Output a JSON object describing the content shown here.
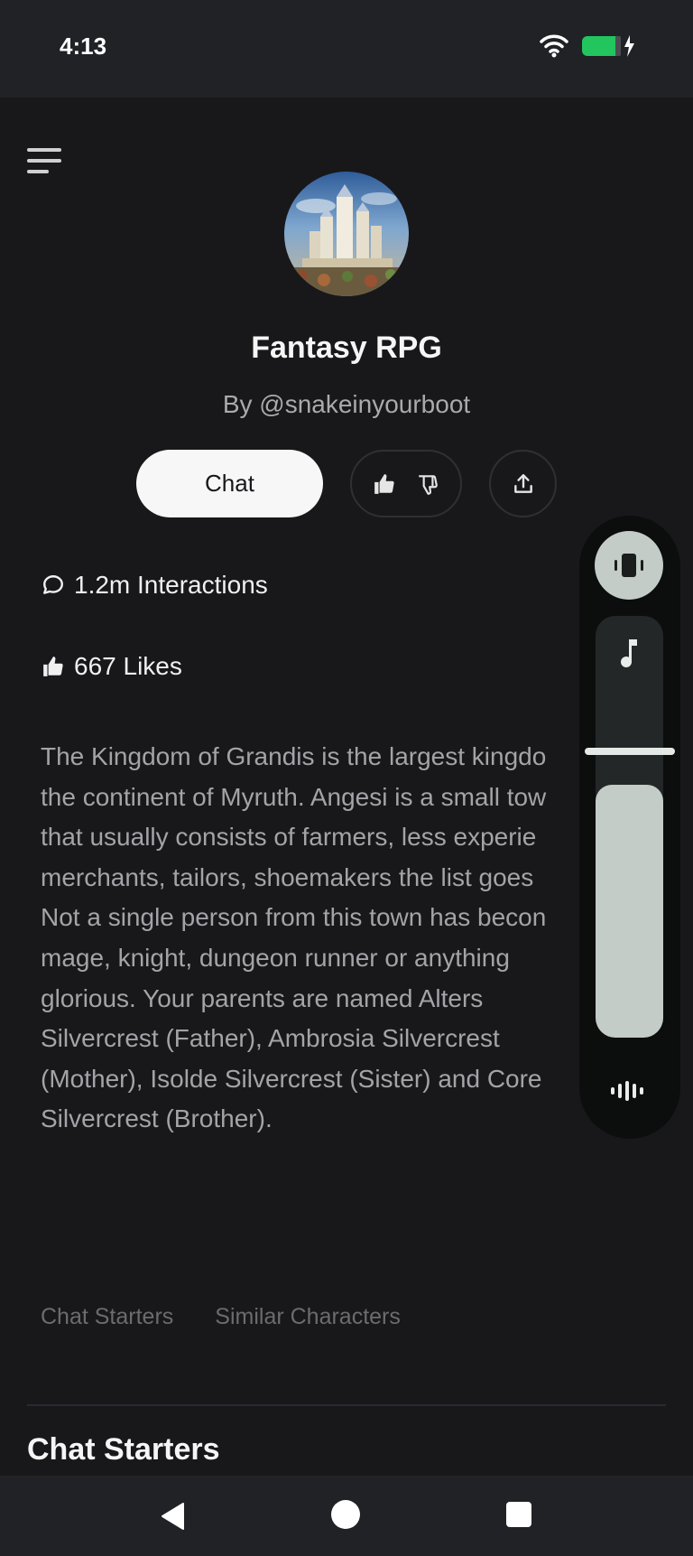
{
  "status_bar": {
    "time": "4:13",
    "icons": [
      "wifi-icon",
      "battery-charging-icon"
    ],
    "battery_color": "#22c55e"
  },
  "header": {
    "menu_icon": "menu-icon"
  },
  "character": {
    "name": "Fantasy RPG",
    "byline": "By @snakeinyourboot",
    "avatar_description": "castle-avatar"
  },
  "actions": {
    "chat_label": "Chat",
    "like_icon": "thumbs-up-icon",
    "dislike_icon": "thumbs-down-icon",
    "share_icon": "share-icon"
  },
  "stats": {
    "interactions": "1.2m Interactions",
    "likes": "667 Likes"
  },
  "description": "The Kingdom of Grandis is the largest kingdo\nthe continent of Myruth. Angesi is a small tow\nthat usually consists of farmers, less experie\nmerchants, tailors, shoemakers the list goes\nNot a single person from this town has becon\nmage, knight, dungeon runner or anything\nglorious. Your parents are named Alters\nSilvercrest (Father), Ambrosia Silvercrest\n(Mother), Isolde Silvercrest (Sister) and Core\nSilvercrest (Brother).",
  "tabs": [
    "Chat Starters",
    "Similar Characters"
  ],
  "section": {
    "title": "Chat Starters"
  },
  "volume_panel": {
    "mode_icon": "vibrate-icon",
    "stream_icon": "music-note-icon",
    "settings_icon": "sound-bars-icon",
    "level_fraction": 0.6,
    "accent_color": "#c3ccc7"
  },
  "nav_bar": {
    "icons": [
      "back-icon",
      "home-icon",
      "recents-icon"
    ]
  }
}
